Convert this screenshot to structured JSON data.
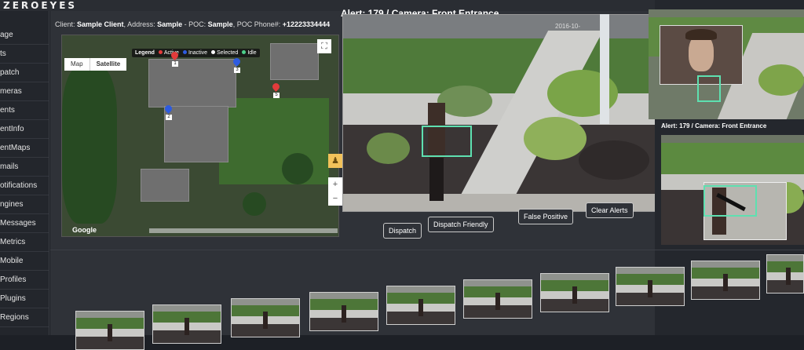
{
  "app": {
    "logo": "ZEROEYES"
  },
  "sidebar": {
    "items": [
      {
        "label": "age"
      },
      {
        "label": "ts"
      },
      {
        "label": "patch"
      },
      {
        "label": "meras"
      },
      {
        "label": "ents"
      },
      {
        "label": "entInfo"
      },
      {
        "label": "entMaps"
      },
      {
        "label": "mails"
      },
      {
        "label": "otifications"
      },
      {
        "label": "ngines"
      },
      {
        "label": "Messages"
      },
      {
        "label": "Metrics"
      },
      {
        "label": "Mobile"
      },
      {
        "label": "Profiles"
      },
      {
        "label": "Plugins"
      },
      {
        "label": "Regions"
      }
    ]
  },
  "client_info": {
    "client_label": "Client:",
    "client": "Sample Client",
    "address_label": "Address:",
    "address": "Sample",
    "poc_label": "- POC:",
    "poc": "Sample",
    "phone_label": "POC Phone#:",
    "phone": "+12223334444"
  },
  "map": {
    "map_type": [
      "Map",
      "Satellite"
    ],
    "selected_type": "Satellite",
    "legend": {
      "title": "Legend",
      "items": [
        {
          "label": "Active",
          "color": "#e23b3b"
        },
        {
          "label": "Inactive",
          "color": "#2d5be0"
        },
        {
          "label": "Selected",
          "color": "#ffffff"
        },
        {
          "label": "Idle",
          "color": "#4cd08a"
        }
      ]
    },
    "pins": [
      {
        "num": "1",
        "color": "#e23b3b"
      },
      {
        "num": "2",
        "color": "#2d5be0"
      },
      {
        "num": "3",
        "color": "#2d5be0"
      },
      {
        "num": "5",
        "color": "#e23b3b"
      }
    ],
    "google_label": "Google",
    "fullscreen_icon": "fullscreen-icon",
    "zoom_in": "+",
    "zoom_out": "−"
  },
  "alert": {
    "title": "Alert: 179 / Camera: Front Entrance",
    "timestamp": "2016-10-"
  },
  "actions": {
    "dispatch": "Dispatch",
    "dispatch_friendly": "Dispatch Friendly",
    "false_positive": "False Positive",
    "clear_alerts": "Clear Alerts"
  },
  "right_panel": {
    "title": "Alert: 179 / Camera: Front Entrance"
  },
  "colors": {
    "detection_box": "#5ee0b0",
    "panel_bg": "#2f3238"
  }
}
